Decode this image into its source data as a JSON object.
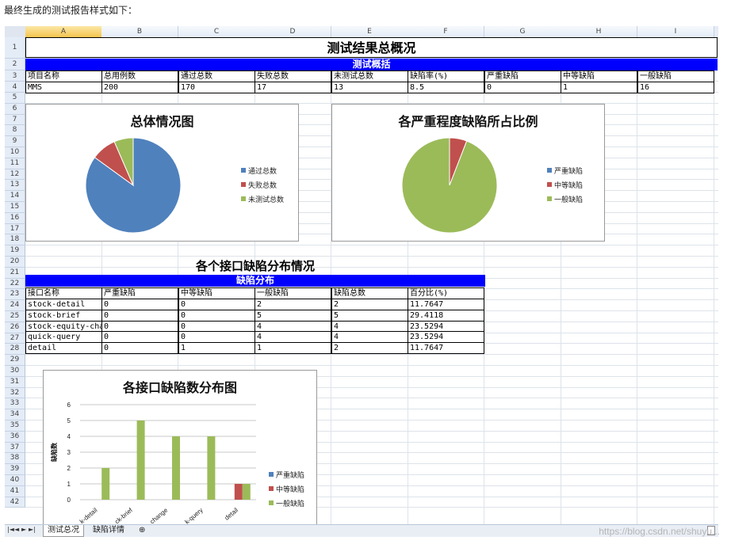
{
  "intro_text": "最终生成的测试报告样式如下：",
  "columns": [
    "A",
    "B",
    "C",
    "D",
    "E",
    "F",
    "G",
    "H",
    "I"
  ],
  "rows": [
    "1",
    "2",
    "3",
    "4",
    "5",
    "6",
    "7",
    "8",
    "9",
    "10",
    "11",
    "12",
    "13",
    "14",
    "15",
    "16",
    "17",
    "18",
    "19",
    "20",
    "21",
    "22",
    "23",
    "24",
    "25",
    "26",
    "27",
    "28",
    "29",
    "30",
    "31",
    "32",
    "33",
    "34",
    "35",
    "36",
    "37",
    "38",
    "39",
    "40",
    "41",
    "42"
  ],
  "summary": {
    "title": "测试结果总概况",
    "band": "测试概括",
    "headers": [
      "项目名称",
      "总用例数",
      "通过总数",
      "失败总数",
      "未测试总数",
      "缺陷率(%)",
      "严重缺陷",
      "中等缺陷",
      "一般缺陷"
    ],
    "values": [
      "MMS",
      "200",
      "170",
      "17",
      "13",
      "8.5",
      "0",
      "1",
      "16"
    ]
  },
  "charts": {
    "overall": {
      "title": "总体情况图",
      "type": "pie",
      "legend": [
        "通过总数",
        "失败总数",
        "未测试总数"
      ],
      "values": [
        170,
        17,
        13
      ],
      "colors": [
        "#4f81bd",
        "#c0504d",
        "#9bbb59"
      ]
    },
    "severity": {
      "title": "各严重程度缺陷所占比例",
      "type": "pie",
      "legend": [
        "严重缺陷",
        "中等缺陷",
        "一般缺陷"
      ],
      "values": [
        0,
        1,
        16
      ],
      "colors": [
        "#4f81bd",
        "#c0504d",
        "#9bbb59"
      ]
    },
    "interface": {
      "title": "各接口缺陷数分布图",
      "type": "bar",
      "ylabel": "缺陷数",
      "yticks": [
        "0",
        "1",
        "2",
        "3",
        "4",
        "5",
        "6"
      ],
      "categories": [
        "stock-detail",
        "stock-brief",
        "stock-equity-change",
        "quick-query",
        "detail"
      ],
      "category_labels": [
        "k-detail",
        "ck-brief",
        "change",
        "k-query",
        "detail"
      ],
      "legend": [
        "严重缺陷",
        "中等缺陷",
        "一般缺陷"
      ],
      "colors": [
        "#4f81bd",
        "#c0504d",
        "#9bbb59"
      ]
    }
  },
  "chart_data": {
    "type": "bar",
    "title": "各接口缺陷数分布图",
    "ylabel": "缺陷数",
    "ylim": [
      0,
      6
    ],
    "categories": [
      "stock-detail",
      "stock-brief",
      "stock-equity-change",
      "quick-query",
      "detail"
    ],
    "series": [
      {
        "name": "严重缺陷",
        "values": [
          0,
          0,
          0,
          0,
          0
        ]
      },
      {
        "name": "中等缺陷",
        "values": [
          0,
          0,
          0,
          0,
          1
        ]
      },
      {
        "name": "一般缺陷",
        "values": [
          2,
          5,
          4,
          4,
          1
        ]
      }
    ]
  },
  "distribution": {
    "title": "各个接口缺陷分布情况",
    "band": "缺陷分布",
    "headers": [
      "接口名称",
      "严重缺陷",
      "中等缺陷",
      "一般缺陷",
      "缺陷总数",
      "百分比(%)"
    ],
    "rows": [
      [
        "stock-detail",
        "0",
        "0",
        "2",
        "2",
        "11.7647"
      ],
      [
        "stock-brief",
        "0",
        "0",
        "5",
        "5",
        "29.4118"
      ],
      [
        "stock-equity-change",
        "0",
        "0",
        "4",
        "4",
        "23.5294"
      ],
      [
        "quick-query",
        "0",
        "0",
        "4",
        "4",
        "23.5294"
      ],
      [
        "detail",
        "0",
        "1",
        "1",
        "2",
        "11.7647"
      ]
    ]
  },
  "tabs": [
    "测试总况",
    "缺陷详情"
  ],
  "tab_nav": [
    "|◄",
    "◄",
    "►",
    "►|"
  ],
  "watermark": "https://blog.csdn.net/shuyu..."
}
